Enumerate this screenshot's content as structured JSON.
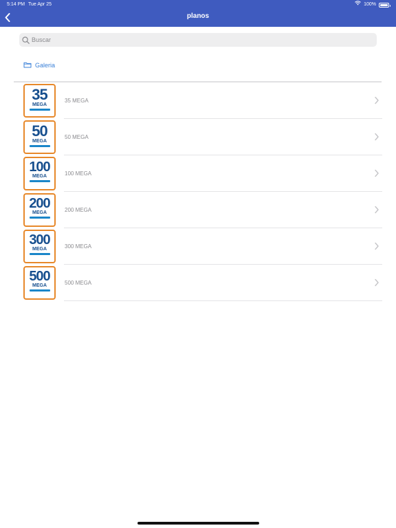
{
  "status_bar": {
    "time": "5:14 PM",
    "date": "Tue Apr 25",
    "battery_text": "100%",
    "battery_level": 1.0
  },
  "nav": {
    "title": "planos",
    "back_icon": "chevron-left-icon"
  },
  "search": {
    "placeholder": "Buscar",
    "value": ""
  },
  "gallery": {
    "label": "Galeria",
    "icon": "folder-icon"
  },
  "colors": {
    "nav_bg": "#3f5bbf",
    "accent": "#3a80d8",
    "thumb_border": "#e7882a",
    "thumb_text": "#174f8e"
  },
  "plans": [
    {
      "number": "35",
      "badge": "MEGA",
      "label": "35 MEGA"
    },
    {
      "number": "50",
      "badge": "MEGA",
      "label": "50 MEGA"
    },
    {
      "number": "100",
      "badge": "MEGA",
      "label": "100 MEGA"
    },
    {
      "number": "200",
      "badge": "MEGA",
      "label": "200 MEGA"
    },
    {
      "number": "300",
      "badge": "MEGA",
      "label": "300 MEGA"
    },
    {
      "number": "500",
      "badge": "MEGA",
      "label": "500 MEGA"
    }
  ]
}
